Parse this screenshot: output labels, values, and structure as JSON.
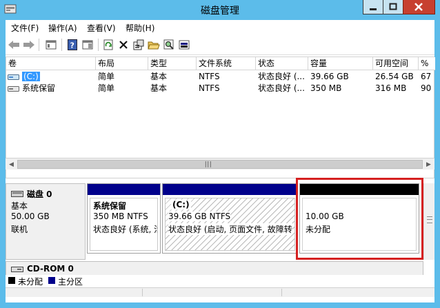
{
  "window": {
    "title": "磁盘管理"
  },
  "menu": {
    "items": [
      {
        "label": "文件(F)"
      },
      {
        "label": "操作(A)"
      },
      {
        "label": "查看(V)"
      },
      {
        "label": "帮助(H)"
      }
    ]
  },
  "toolbar": {
    "buttons": [
      "back-icon",
      "forward-icon",
      "console-tree-icon",
      "help-icon",
      "properties-pane-icon",
      "refresh-icon",
      "delete-icon",
      "properties-icon",
      "open-icon",
      "search-icon",
      "disk-view-icon"
    ]
  },
  "volumes": {
    "columns": [
      "卷",
      "布局",
      "类型",
      "文件系统",
      "状态",
      "容量",
      "可用空间",
      "%"
    ],
    "rows": [
      {
        "name": "(C:)",
        "layout": "简单",
        "type": "基本",
        "fs": "NTFS",
        "status": "状态良好 (...",
        "capacity": "39.66 GB",
        "free": "26.54 GB",
        "pct": "67"
      },
      {
        "name": "系统保留",
        "layout": "简单",
        "type": "基本",
        "fs": "NTFS",
        "status": "状态良好 (...",
        "capacity": "350 MB",
        "free": "316 MB",
        "pct": "90"
      }
    ]
  },
  "disk0": {
    "name": "磁盘 0",
    "type": "基本",
    "size": "50.00 GB",
    "state": "联机",
    "partitions": [
      {
        "title": "系统保留",
        "size": "350 MB NTFS",
        "status": "状态良好 (系统, 活"
      },
      {
        "title": "(C:)",
        "size": "39.66 GB NTFS",
        "status": "状态良好 (启动, 页面文件, 故障转"
      },
      {
        "title": "",
        "size": "10.00 GB",
        "status": "未分配"
      }
    ]
  },
  "cdrom": {
    "name": "CD-ROM 0"
  },
  "legend": {
    "unallocated": "未分配",
    "primary": "主分区"
  },
  "colors": {
    "primary_partition": "#00008b",
    "unallocated": "#000000",
    "highlight": "#d52020",
    "titlebar": "#5cbcea"
  }
}
